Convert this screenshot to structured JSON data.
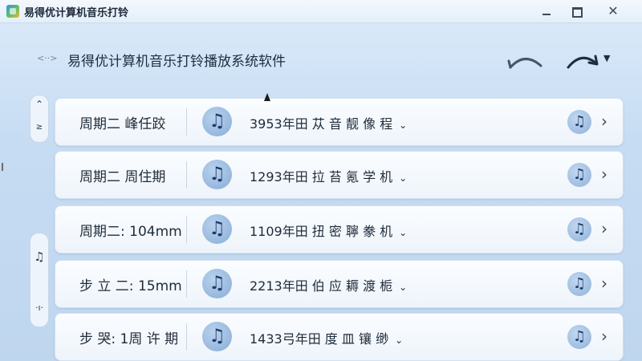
{
  "window": {
    "title": "易得优计算机音乐打铃"
  },
  "header": {
    "title": "易得优计算机音乐打铃播放系统软件"
  },
  "rows": [
    {
      "day": "周期二 峰任跤",
      "text": "3953年田 苁 音 靓  像 程"
    },
    {
      "day": "周期二 周住期",
      "text": "1293年田 拉 苔  氪 学 机"
    },
    {
      "day": "周期二: 104mm",
      "text": "1109年田 扭 密 聹  豢 机"
    },
    {
      "day": "步 立 二: 15mm",
      "text": "2213年田 伯 应 耨 渡 栀"
    },
    {
      "day": "步 哭: 1周 许 期",
      "text": "1433弓年田 度 皿  镶 缈"
    }
  ]
}
